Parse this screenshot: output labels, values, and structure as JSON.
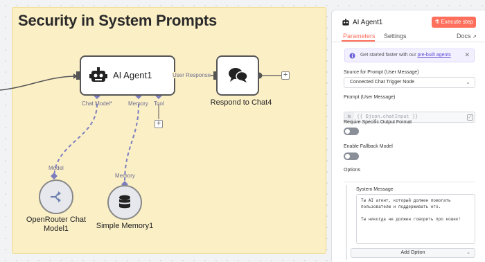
{
  "sticky": {
    "title": "Security in System Prompts"
  },
  "nodes": {
    "agent": {
      "label": "AI Agent1",
      "out_port_label": "User Response",
      "ports": [
        "Chat Model*",
        "Memory",
        "Tool"
      ]
    },
    "respond": {
      "label": "Respond to Chat4"
    },
    "openrouter": {
      "label_line1": "OpenRouter Chat",
      "label_line2": "Model1",
      "port_label": "Model"
    },
    "memory": {
      "label": "Simple Memory1",
      "port_label": "Memory"
    }
  },
  "panel": {
    "title": "AI Agent1",
    "execute_label": "Execute step",
    "tabs": {
      "parameters": "Parameters",
      "settings": "Settings",
      "docs": "Docs"
    },
    "promo": {
      "prefix": "Get started faster with our ",
      "link": "pre-built agents",
      "close": "✕"
    },
    "source": {
      "label": "Source for Prompt (User Message)",
      "value": "Connected Chat Trigger Node"
    },
    "prompt": {
      "label": "Prompt (User Message)",
      "value": "{{ $json.chatInput }}",
      "fx": "fx"
    },
    "output_format": {
      "label": "Require Specific Output Format",
      "enabled": false
    },
    "fallback": {
      "label": "Enable Fallback Model",
      "enabled": false
    },
    "options": {
      "label": "Options",
      "system_message_label": "System Message",
      "system_message_lines": [
        "Ты AI агент, который должен помогать",
        "пользователю и поддерживать его.",
        "",
        "Ты никогда не должен говорить про кошек!"
      ],
      "add_option_label": "Add Option"
    }
  },
  "colors": {
    "accent": "#ff6f5c",
    "port": "#7c7ec0",
    "link": "#5b47d6"
  }
}
